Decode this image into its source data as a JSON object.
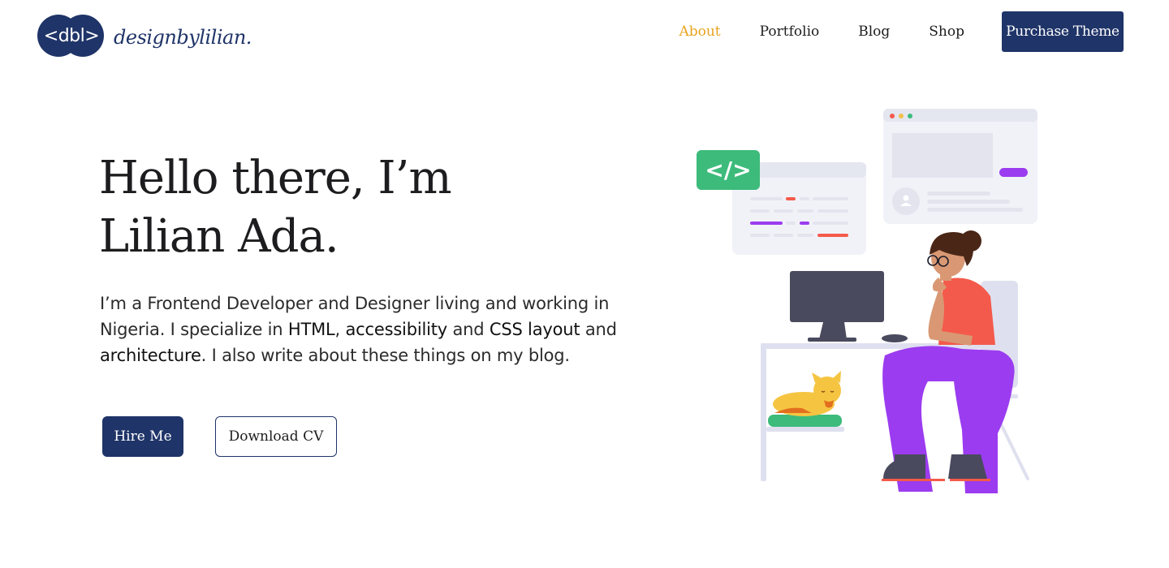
{
  "brand": {
    "logo_mark": "<dbl>",
    "name": "designbylilian."
  },
  "nav": {
    "items": [
      {
        "label": "About"
      },
      {
        "label": "Portfolio"
      },
      {
        "label": "Blog"
      },
      {
        "label": "Shop"
      }
    ],
    "cta": "Purchase Theme"
  },
  "hero": {
    "title_line1": "Hello there, I’m",
    "title_line2": "Lilian Ada.",
    "intro": {
      "p1": "I’m a  Frontend Developer and Designer living and working in Nigeria. I specialize in ",
      "s1": "HTML",
      "p2": ", ",
      "s2": "accessibility",
      "p3": " and ",
      "s3": "CSS layout",
      "p4": " and ",
      "s4": "architecture",
      "p5": ". I also write about these things on my blog."
    },
    "buttons": {
      "hire": "Hire Me",
      "cv": "Download CV"
    },
    "code_badge": "</>"
  },
  "colors": {
    "brand_navy": "#1f3468",
    "nav_active": "#e8a31d",
    "accent_green": "#3dbb7b",
    "accent_purple": "#9b3cf0",
    "accent_coral": "#f45a4b"
  },
  "icons": {
    "code": "code-icon",
    "avatar": "user-avatar-icon"
  }
}
